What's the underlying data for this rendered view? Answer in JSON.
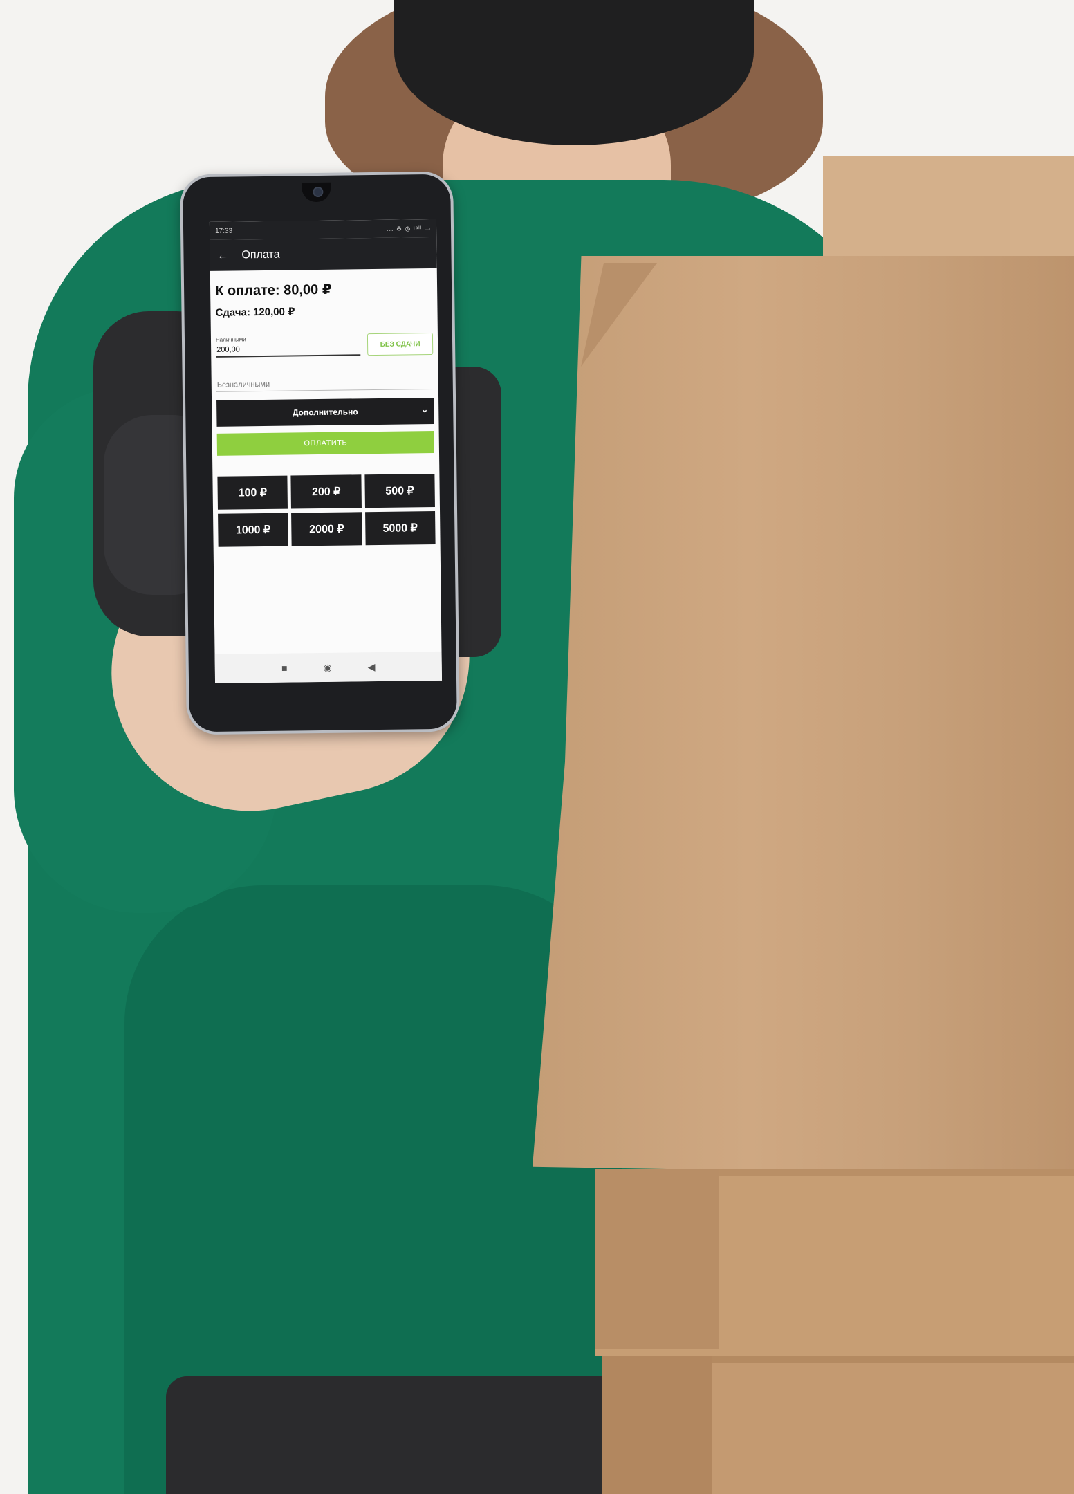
{
  "status_bar": {
    "time": "17:33",
    "icons": "... ⚙ ◷ ᵗᵃˡˡ ▭"
  },
  "app_bar": {
    "back_icon": "arrow-left-icon",
    "title": "Оплата"
  },
  "payment": {
    "amount_due": "К оплате: 80,00 ₽",
    "change": "Сдача: 120,00 ₽",
    "cash_label": "Наличными",
    "cash_value": "200,00",
    "no_change_label": "БЕЗ СДАЧИ",
    "cashless_placeholder": "Безналичными",
    "additional_label": "Дополнительно",
    "pay_label": "ОПЛАТИТЬ"
  },
  "quick_amounts": [
    "100 ₽",
    "200 ₽",
    "500 ₽",
    "1000 ₽",
    "2000 ₽",
    "5000 ₽"
  ],
  "nav_bar": {
    "recents_glyph": "■",
    "home_glyph": "◉",
    "back_glyph": "◀"
  },
  "colors": {
    "accent_green": "#8fcf3f",
    "dark": "#1f1f21",
    "shirt": "#137a5a",
    "kraft": "#c9a27c"
  }
}
